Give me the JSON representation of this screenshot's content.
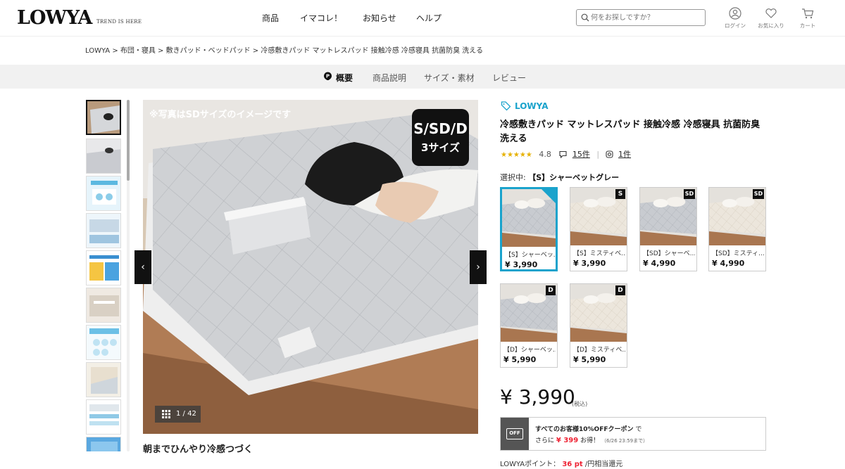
{
  "header": {
    "logo": "LOWYA",
    "logo_tagline": "TREND IS HERE",
    "nav": [
      "商品",
      "イマコレ！",
      "お知らせ",
      "ヘルプ"
    ],
    "search_placeholder": "何をお探しですか？",
    "login": "ログイン",
    "favorites": "お気に入り",
    "cart": "カート"
  },
  "breadcrumb": "LOWYA > 布団・寝具 > 敷きパッド・ベッドパッド > 冷感敷きパッド マットレスパッド 接触冷感 冷感寝具 抗菌防臭 洗える",
  "tabs": [
    "概要",
    "商品説明",
    "サイズ・素材",
    "レビュー"
  ],
  "gallery": {
    "notice": "※写真はSDサイズのイメージです",
    "badge_line1": "S/SD/D",
    "badge_line2": "3サイズ",
    "counter": "1 / 42",
    "caption": "朝までひんやり冷感つづく",
    "prev": "‹",
    "next": "›"
  },
  "product": {
    "brand": "LOWYA",
    "title": "冷感敷きパッド マットレスパッド 接触冷感 冷感寝具 抗菌防臭 洗える",
    "stars": "★★★★★",
    "rating": "4.8",
    "reviews": "15件",
    "instagram": "1件",
    "selected_prefix": "選択中:",
    "selected_value": "【S】シャーベットグレー",
    "variants": [
      {
        "name": "【S】シャーベッ...",
        "price": "¥ 3,990",
        "badge": "S",
        "color": "grey"
      },
      {
        "name": "【S】ミスティベ...",
        "price": "¥ 3,990",
        "badge": "S",
        "color": "beige"
      },
      {
        "name": "【SD】シャーベ...",
        "price": "¥ 4,990",
        "badge": "SD",
        "color": "grey"
      },
      {
        "name": "【SD】ミスティ...",
        "price": "¥ 4,990",
        "badge": "SD",
        "color": "beige"
      },
      {
        "name": "【D】シャーベッ...",
        "price": "¥ 5,990",
        "badge": "D",
        "color": "grey"
      },
      {
        "name": "【D】ミスティベ...",
        "price": "¥ 5,990",
        "badge": "D",
        "color": "beige"
      }
    ],
    "price": "¥ 3,990",
    "tax": "(税込)",
    "coupon_icon": "OFF",
    "coupon_line1": "すべてのお客様10%OFFクーポン",
    "coupon_line1_suffix": "で",
    "coupon_line2_prefix": "さらに",
    "coupon_amount": "¥ 399",
    "coupon_line2_suffix": "お得！",
    "coupon_deadline": "（6/26 23:59まで）",
    "points_label": "LOWYAポイント：",
    "points_value": "36 pt",
    "points_suffix": "/円相当還元"
  },
  "colors": {
    "accent": "#1aa3cc",
    "sale": "#ee2233",
    "star": "#e6b100"
  }
}
